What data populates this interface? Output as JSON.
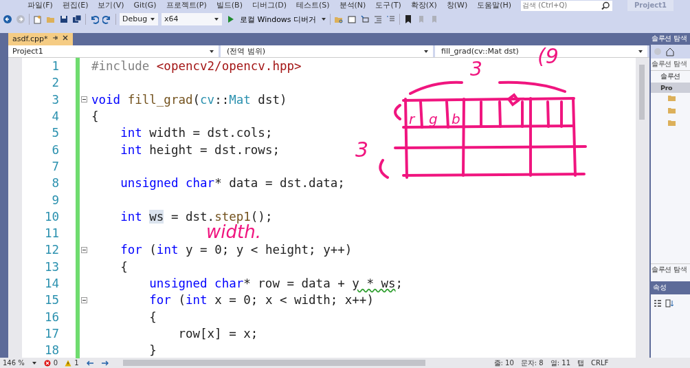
{
  "menu": [
    "파일(F)",
    "편집(E)",
    "보기(V)",
    "Git(G)",
    "프로젝트(P)",
    "빌드(B)",
    "디버그(D)",
    "테스트(S)",
    "분석(N)",
    "도구(T)",
    "확장(X)",
    "창(W)",
    "도움말(H)"
  ],
  "toolbar": {
    "configuration": "Debug",
    "platform": "x64",
    "run_label": "로컬 Windows 디버거",
    "search": {
      "placeholder": "검색 (Ctrl+Q)"
    },
    "project_badge": "Project1"
  },
  "tabs": [
    {
      "label": "asdf.cpp*",
      "selected": true
    }
  ],
  "nav": {
    "project": "Project1",
    "scope": "(전역 범위)",
    "member": "fill_grad(cv::Mat dst)"
  },
  "lines": [
    {
      "number": "1",
      "fold": false,
      "tokens": [
        {
          "text": "#include ",
          "kind": "pre"
        },
        {
          "text": "<opencv2/opencv.hpp>",
          "kind": "str"
        }
      ]
    },
    {
      "number": "2",
      "fold": false
    },
    {
      "number": "3",
      "fold": true,
      "tokens": [
        {
          "text": "void ",
          "kind": "kw"
        },
        {
          "text": "fill_grad",
          "kind": "fn"
        },
        {
          "text": "(",
          "kind": "plain"
        },
        {
          "text": "cv",
          "kind": "type"
        },
        {
          "text": "::",
          "kind": "plain"
        },
        {
          "text": "Mat",
          "kind": "type"
        },
        {
          "text": " dst)",
          "kind": "plain"
        }
      ]
    },
    {
      "number": "4",
      "fold": false,
      "tokens": [
        {
          "text": "{",
          "kind": "plain"
        }
      ]
    },
    {
      "number": "5",
      "fold": false,
      "tokens": [
        {
          "text": "    int",
          "kind": "kw"
        },
        {
          "text": " width = dst.cols;",
          "kind": "plain"
        }
      ]
    },
    {
      "number": "6",
      "fold": false,
      "tokens": [
        {
          "text": "    int",
          "kind": "kw"
        },
        {
          "text": " height = dst.rows;",
          "kind": "plain"
        }
      ]
    },
    {
      "number": "7",
      "fold": false
    },
    {
      "number": "8",
      "fold": false,
      "tokens": [
        {
          "text": "    unsigned char",
          "kind": "kw"
        },
        {
          "text": "* data = dst.data;",
          "kind": "plain"
        }
      ]
    },
    {
      "number": "9",
      "fold": false
    },
    {
      "number": "10",
      "fold": false,
      "tokens": [
        {
          "text": "    int ",
          "kind": "kw"
        },
        {
          "text": "ws",
          "kind": "ref"
        },
        {
          "text": " = dst.",
          "kind": "plain"
        },
        {
          "text": "step1",
          "kind": "fn"
        },
        {
          "text": "();",
          "kind": "plain"
        }
      ]
    },
    {
      "number": "11",
      "fold": false
    },
    {
      "number": "12",
      "fold": true,
      "tokens": [
        {
          "text": "    for",
          "kind": "kw"
        },
        {
          "text": " (",
          "kind": "plain"
        },
        {
          "text": "int",
          "kind": "kw"
        },
        {
          "text": " y = 0; y < height; y++)",
          "kind": "plain"
        }
      ]
    },
    {
      "number": "13",
      "fold": false,
      "tokens": [
        {
          "text": "    {",
          "kind": "plain"
        }
      ]
    },
    {
      "number": "14",
      "fold": false,
      "tokens": [
        {
          "text": "        unsigned char",
          "kind": "kw"
        },
        {
          "text": "* row = data + ",
          "kind": "plain"
        },
        {
          "text": "y * ws",
          "kind": "squiggle"
        },
        {
          "text": ";",
          "kind": "plain"
        }
      ]
    },
    {
      "number": "15",
      "fold": true,
      "tokens": [
        {
          "text": "        for",
          "kind": "kw"
        },
        {
          "text": " (",
          "kind": "plain"
        },
        {
          "text": "int",
          "kind": "kw"
        },
        {
          "text": " x = 0; x < width; x++)",
          "kind": "plain"
        }
      ]
    },
    {
      "number": "16",
      "fold": false,
      "tokens": [
        {
          "text": "        {",
          "kind": "plain"
        }
      ]
    },
    {
      "number": "17",
      "fold": false,
      "tokens": [
        {
          "text": "            row[x] = x;",
          "kind": "plain"
        }
      ]
    },
    {
      "number": "18",
      "fold": false,
      "tokens": [
        {
          "text": "        }",
          "kind": "plain"
        }
      ]
    }
  ],
  "annotations": [
    "3",
    "(9",
    "3",
    "width.",
    "r",
    "g",
    "b"
  ],
  "solution_explorer": {
    "title": "솔루션 탐색",
    "search": "솔루션 탐색",
    "items": [
      {
        "label": "솔루션",
        "selected": false
      },
      {
        "label": "Pro",
        "selected": true
      }
    ],
    "bottom_tab": "솔루션 탐색"
  },
  "properties": {
    "title": "속성"
  },
  "status_bar": {
    "zoom": "146 %",
    "errors": "0",
    "warnings": "1",
    "line": "줄: 10",
    "char": "문자: 8",
    "col": "열: 11",
    "tab": "탭",
    "eol": "CRLF"
  }
}
